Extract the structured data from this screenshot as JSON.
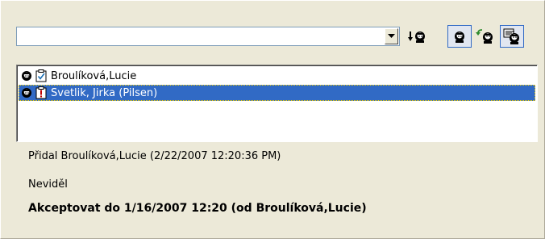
{
  "toolbar": {
    "combo_value": "",
    "icons": [
      "dropdown-arrow",
      "add-user-down",
      "user-view",
      "user-reply",
      "user-forward"
    ]
  },
  "list": {
    "items": [
      {
        "label": "Broulíková,Lucie",
        "status": "checked"
      },
      {
        "label": "Svetlik, Jirka (Pilsen)",
        "status": "important",
        "selected": true
      }
    ]
  },
  "details": {
    "added_line": "Přidal Broulíková,Lucie (2/22/2007 12:20:36 PM)",
    "seen_line": "Neviděl",
    "accept_line": "Akceptovat do 1/16/2007 12:20 (od Broulíková,Lucie)"
  },
  "colors": {
    "background": "#ece9d8",
    "selection": "#316ac5",
    "border": "#7f9db9"
  }
}
